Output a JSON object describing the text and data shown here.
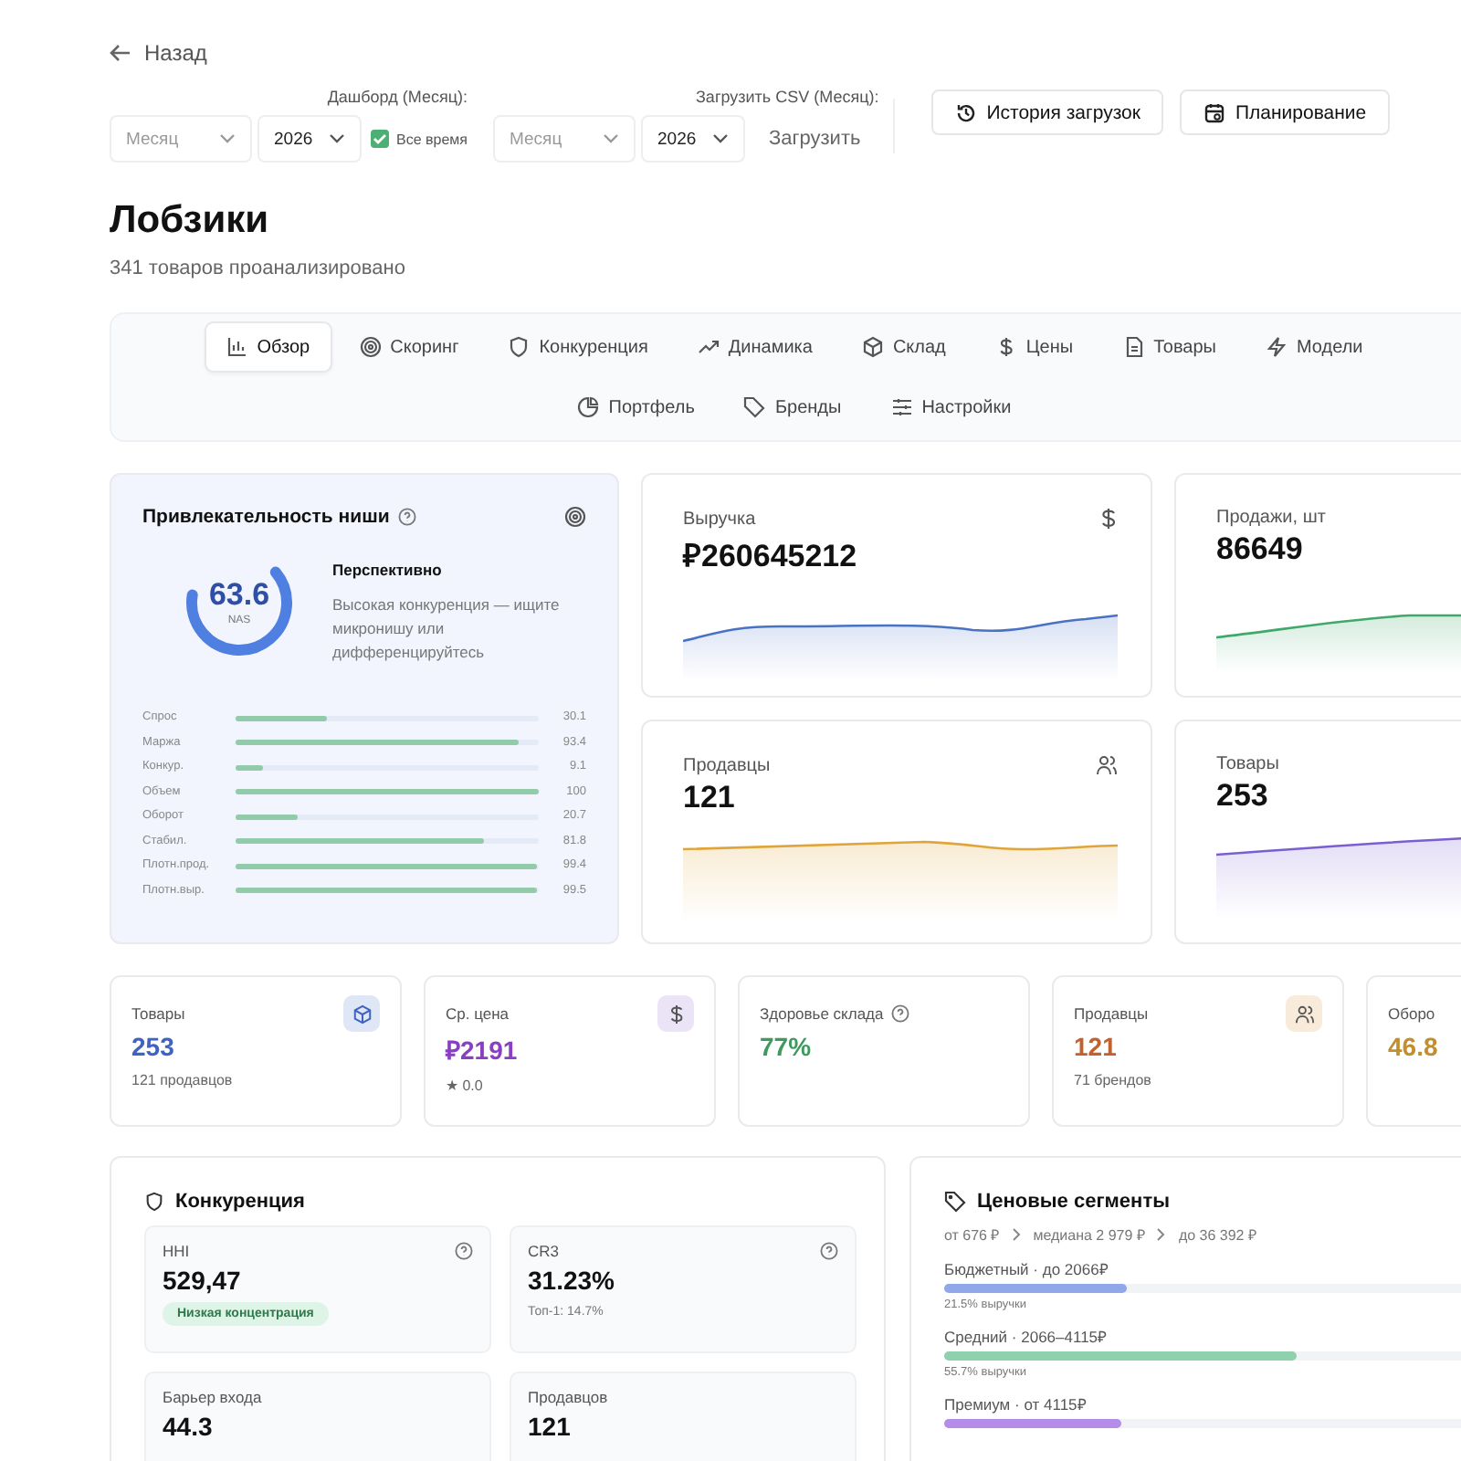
{
  "back": {
    "label": "Назад"
  },
  "dashboard_filter": {
    "label": "Дашборд (Месяц):",
    "month_placeholder": "Месяц",
    "year": "2026",
    "all_time": {
      "label": "Все время",
      "checked": true
    }
  },
  "upload_filter": {
    "label": "Загрузить CSV (Месяц):",
    "month_placeholder": "Месяц",
    "year": "2026",
    "button": "Загрузить"
  },
  "buttons": [
    "История загрузок",
    "Планирование"
  ],
  "title": "Лобзики",
  "subtitle": "341 товаров проанализировано",
  "tabs": [
    {
      "label": "Обзор",
      "selected": true
    },
    {
      "label": "Скоринг",
      "selected": false
    },
    {
      "label": "Конкуренция",
      "selected": false
    },
    {
      "label": "Динамика",
      "selected": false
    },
    {
      "label": "Склад",
      "selected": false
    },
    {
      "label": "Цены",
      "selected": false
    },
    {
      "label": "Товары",
      "selected": false
    },
    {
      "label": "Модели",
      "selected": false
    },
    {
      "label": "Портфель",
      "selected": false
    },
    {
      "label": "Бренды",
      "selected": false
    },
    {
      "label": "Настройки",
      "selected": false
    }
  ],
  "attractiveness": {
    "title": "Привлекательность ниши",
    "score": "63.6",
    "score_label": "NAS",
    "level": 0.636,
    "verdict": "Перспективно",
    "description": "Высокая конкуренция — ищите микронишу или дифференцируйтесь",
    "factors": [
      {
        "label": "Спрос",
        "level": 0.301,
        "value": "30.1"
      },
      {
        "label": "Маржа",
        "level": 0.934,
        "value": "93.4"
      },
      {
        "label": "Конкур.",
        "level": 0.091,
        "value": "9.1"
      },
      {
        "label": "Объем",
        "level": 1.0,
        "value": "100"
      },
      {
        "label": "Оборот",
        "level": 0.207,
        "value": "20.7"
      },
      {
        "label": "Стабил.",
        "level": 0.818,
        "value": "81.8"
      },
      {
        "label": "Плотн.прод.",
        "level": 0.994,
        "value": "99.4"
      },
      {
        "label": "Плотн.выр.",
        "level": 0.995,
        "value": "99.5"
      }
    ]
  },
  "kpis": [
    {
      "label": "Выручка",
      "value": "₽260645212",
      "color": "#4a72c4"
    },
    {
      "label": "Продажи, шт",
      "value": "86649",
      "color": "#3fa86b"
    },
    {
      "label": "Продавцы",
      "value": "121",
      "color": "#e0a53a"
    },
    {
      "label": "Товары",
      "value": "253",
      "color": "#7a5fd0"
    }
  ],
  "stats": [
    {
      "label": "Товары",
      "value": "253",
      "note": "121 продавцов",
      "color": "#3f63c2"
    },
    {
      "label": "Ср. цена",
      "value": "₽2191",
      "note": "★ 0.0",
      "color": "#8a3fc2"
    },
    {
      "label": "Здоровье склада",
      "value": "77%",
      "color": "#3f9a5c"
    },
    {
      "label": "Продавцы",
      "value": "121",
      "note": "71 брендов",
      "color": "#c2602e"
    },
    {
      "label": "Оборо",
      "value": "46.8",
      "color": "#c28e2e"
    }
  ],
  "competition": {
    "title": "Конкуренция",
    "metrics": [
      {
        "label": "HHI",
        "value": "529,47",
        "badge": "Низкая концентрация"
      },
      {
        "label": "CR3",
        "value": "31.23%",
        "note": "Топ-1: 14.7%"
      },
      {
        "label": "Барьер входа",
        "value": "44.3"
      },
      {
        "label": "Продавцов",
        "value": "121"
      }
    ]
  },
  "price_segments": {
    "title": "Ценовые сегменты",
    "range": [
      "от 676 ₽",
      "медиана 2 979 ₽",
      "до 36 392 ₽"
    ],
    "segments": [
      {
        "label": "Бюджетный · до 2066₽",
        "level": 0.29,
        "note": "21.5% выручки",
        "color": "#8fa9e8"
      },
      {
        "label": "Средний · 2066–4115₽",
        "level": 0.557,
        "note": "55.7% выручки",
        "color": "#8fd0ad"
      },
      {
        "label": "Премиум · от 4115₽",
        "level": 0.28,
        "color": "#b58de8"
      }
    ]
  }
}
